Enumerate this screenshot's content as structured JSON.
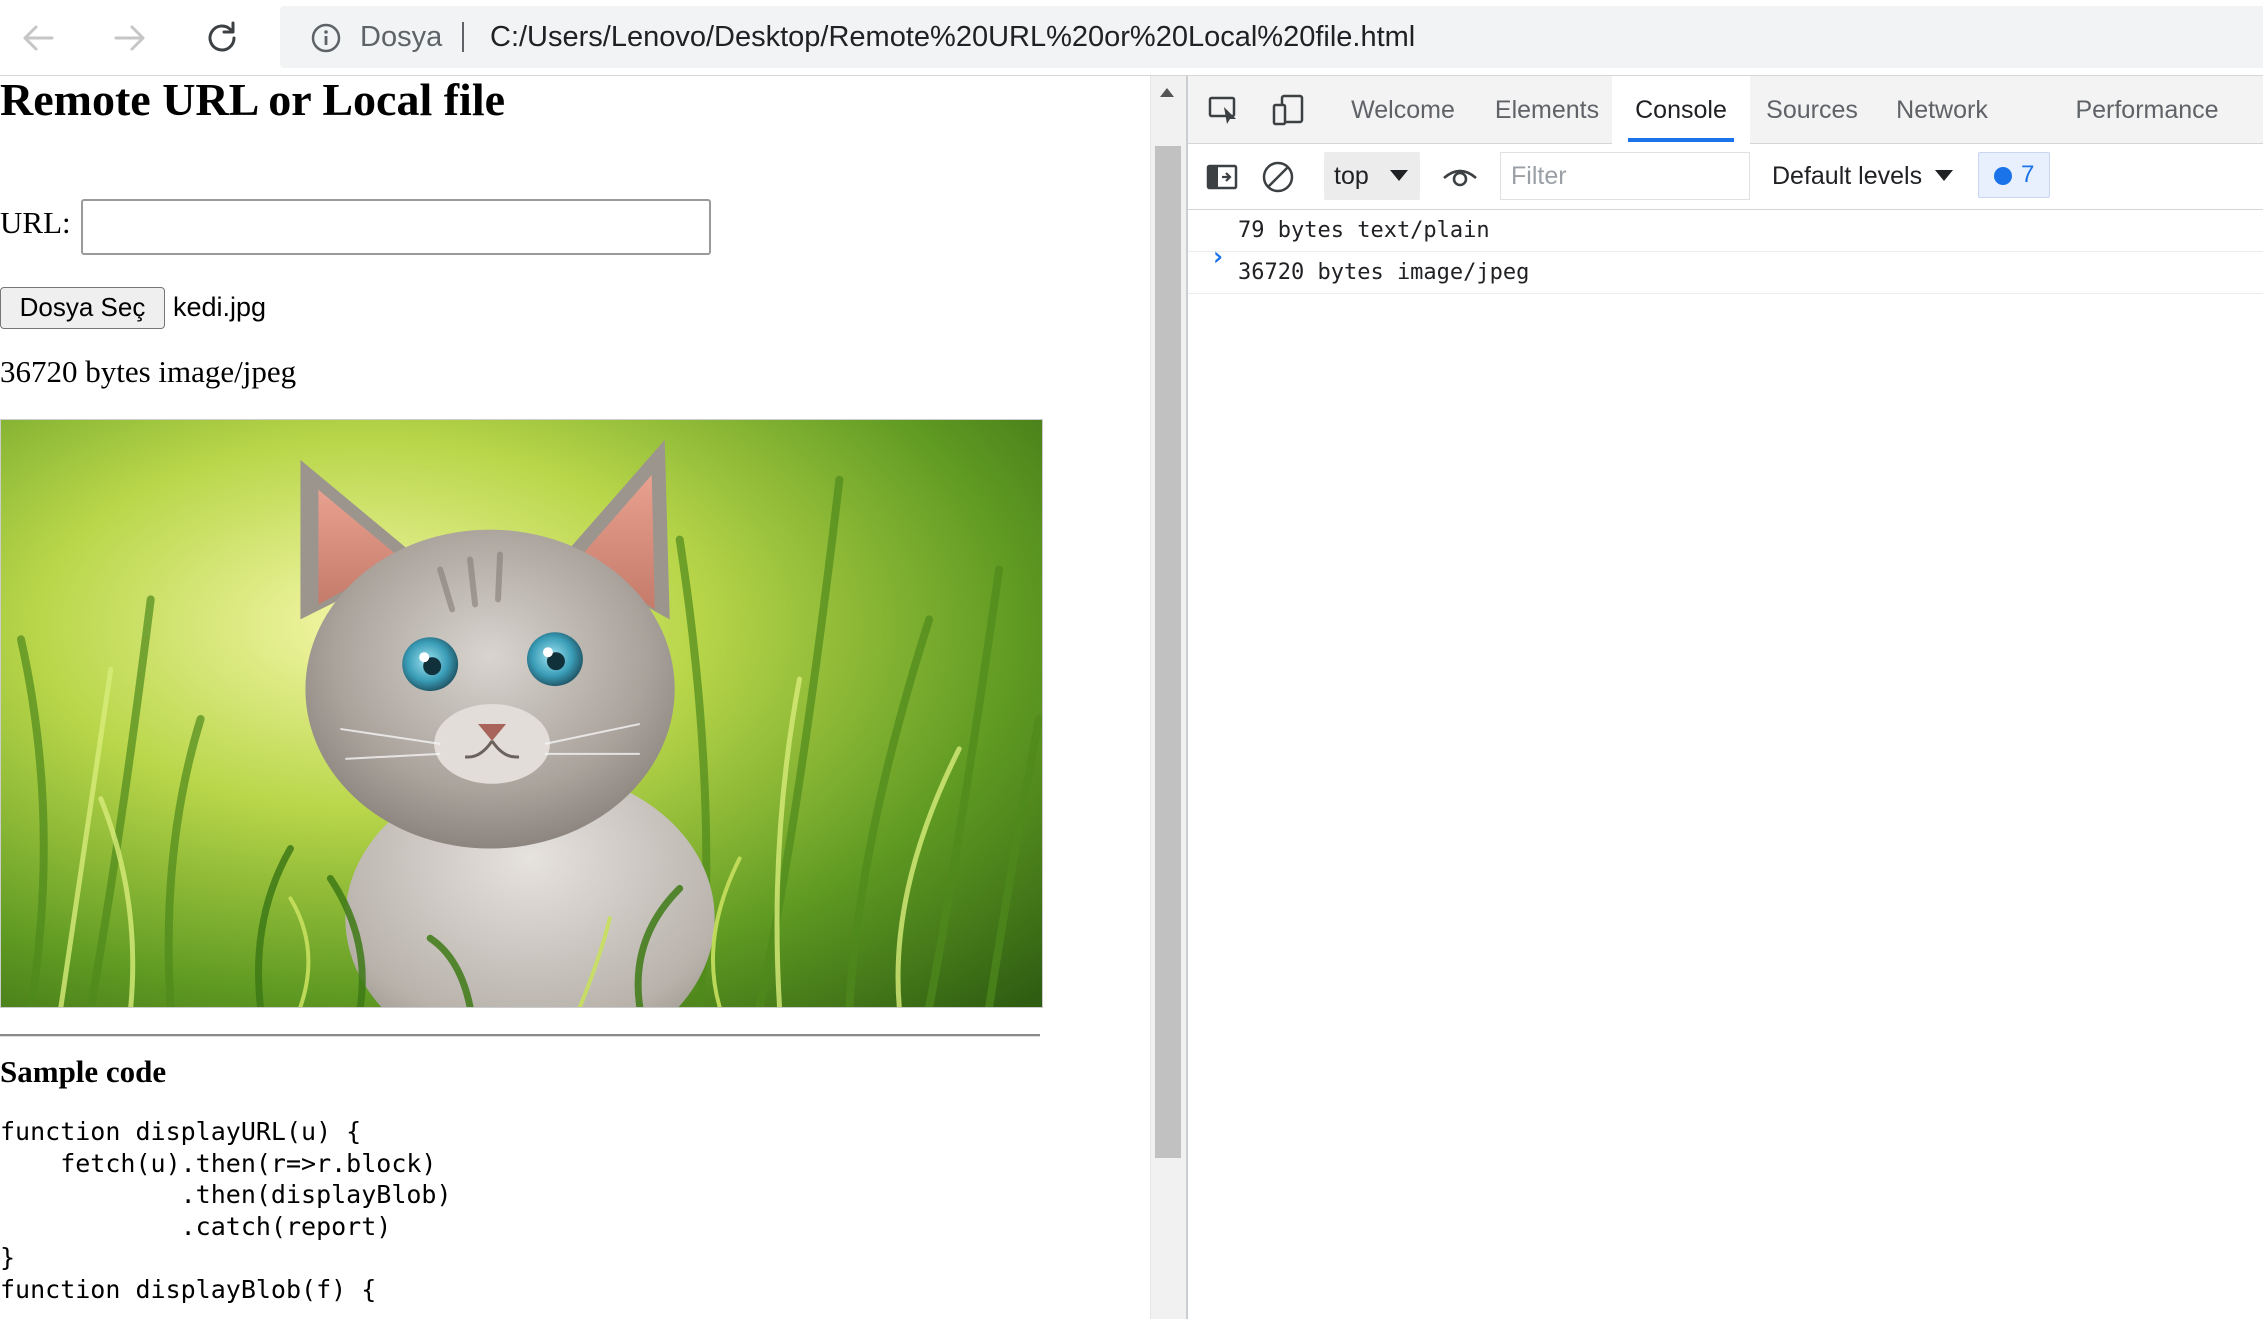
{
  "browser": {
    "address": {
      "source_label": "Dosya",
      "url": "C:/Users/Lenovo/Desktop/Remote%20URL%20or%20Local%20file.html"
    },
    "icons": [
      "back-arrow-icon",
      "forward-arrow-icon",
      "reload-icon",
      "info-icon"
    ]
  },
  "page": {
    "title": "Remote URL or Local file",
    "url_label": "URL:",
    "url_value": "",
    "file_button_label": "Dosya Seç",
    "file_name": "kedi.jpg",
    "result_text": "36720 bytes image/jpeg",
    "sample_heading": "Sample code",
    "sample_code": "function displayURL(u) {\n    fetch(u).then(r=>r.block)\n            .then(displayBlob)\n            .catch(report)\n}\nfunction displayBlob(f) {\n    ..."
  },
  "devtools": {
    "tabs": [
      {
        "label": "Welcome",
        "active": false
      },
      {
        "label": "Elements",
        "active": false
      },
      {
        "label": "Console",
        "active": true
      },
      {
        "label": "Sources",
        "active": false
      },
      {
        "label": "Network",
        "active": false
      },
      {
        "label": "Performance",
        "active": false
      }
    ],
    "context": "top",
    "filter_placeholder": "Filter",
    "levels_label": "Default levels",
    "issues_count": "7",
    "console_lines": [
      "79 bytes text/plain",
      "36720 bytes image/jpeg"
    ],
    "prompt_symbol": "›",
    "colors": {
      "accent": "#1a73e8",
      "tabbar_bg": "#f3f3f3",
      "active_tab_bg": "#ffffff"
    }
  }
}
